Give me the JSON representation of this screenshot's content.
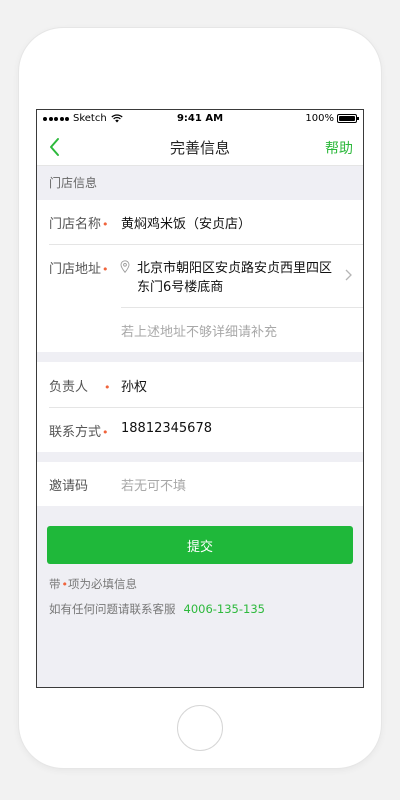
{
  "status_bar": {
    "carrier": "Sketch",
    "time": "9:41 AM",
    "battery": "100%"
  },
  "nav": {
    "title": "完善信息",
    "help_label": "帮助"
  },
  "store_section": {
    "header": "门店信息",
    "name_label": "门店名称",
    "name_value": "黄焖鸡米饭（安贞店）",
    "address_label": "门店地址",
    "address_value": "北京市朝阳区安贞路安贞西里四区东门6号楼底商",
    "address_detail_placeholder": "若上述地址不够详细请补充"
  },
  "contact_section": {
    "person_label": "负责人",
    "person_value": "孙权",
    "phone_label": "联系方式",
    "phone_value": "18812345678"
  },
  "invite_section": {
    "invite_label": "邀请码",
    "invite_placeholder": "若无可不填"
  },
  "submit_label": "提交",
  "notes": {
    "required_prefix": "带",
    "required_mark": "•",
    "required_suffix": "项为必填信息",
    "contact_text": "如有任何问题请联系客服",
    "contact_phone": "4006-135-135"
  },
  "colors": {
    "accent": "#1fb83a",
    "required": "#f0643c"
  }
}
